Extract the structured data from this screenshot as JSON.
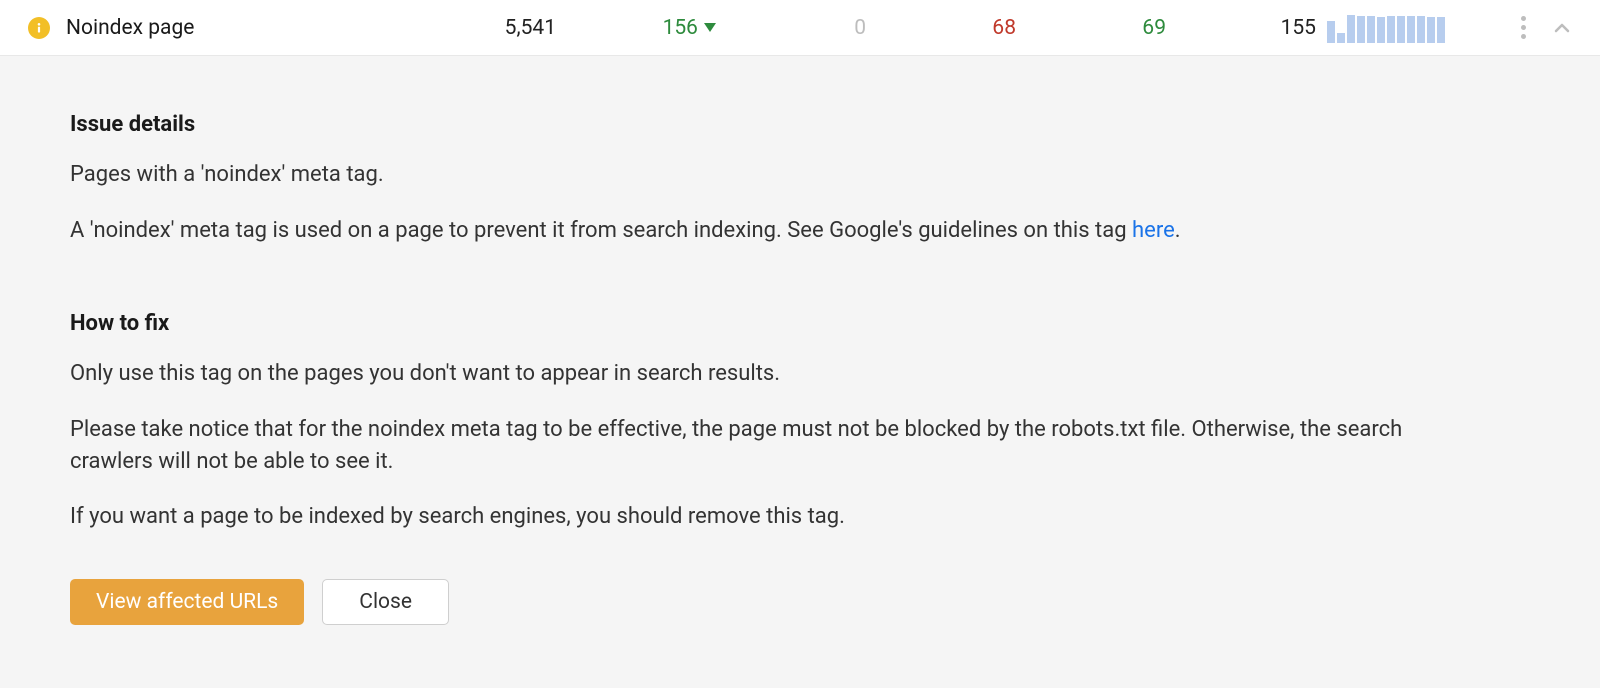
{
  "row": {
    "issue_name": "Noindex page",
    "icon": "info-icon",
    "total": "5,541",
    "delta": "156",
    "zero": "0",
    "red": "68",
    "green": "69",
    "last": "155",
    "spark": [
      22,
      10,
      28,
      27,
      27,
      26,
      27,
      27,
      27,
      27,
      26,
      26
    ]
  },
  "details": {
    "heading": "Issue details",
    "p1": "Pages with a 'noindex' meta tag.",
    "p2_pre": "A 'noindex' meta tag is used on a page to prevent it from search indexing. See Google's guidelines on this tag ",
    "p2_link": "here",
    "p2_post": "."
  },
  "fix": {
    "heading": "How to fix",
    "p1": "Only use this tag on the pages you don't want to appear in search results.",
    "p2": "Please take notice that for the noindex meta tag to be effective, the page must not be blocked by the robots.txt file. Otherwise, the search crawlers will not be able to see it.",
    "p3": "If you want a page to be indexed by search engines, you should remove this tag."
  },
  "buttons": {
    "primary": "View affected URLs",
    "secondary": "Close"
  },
  "chart_data": {
    "type": "bar",
    "title": "",
    "categories": [
      "1",
      "2",
      "3",
      "4",
      "5",
      "6",
      "7",
      "8",
      "9",
      "10",
      "11",
      "12"
    ],
    "values": [
      22,
      10,
      28,
      27,
      27,
      26,
      27,
      27,
      27,
      27,
      26,
      26
    ],
    "note": "Sparkline — relative bar heights only, no axes shown in UI"
  }
}
